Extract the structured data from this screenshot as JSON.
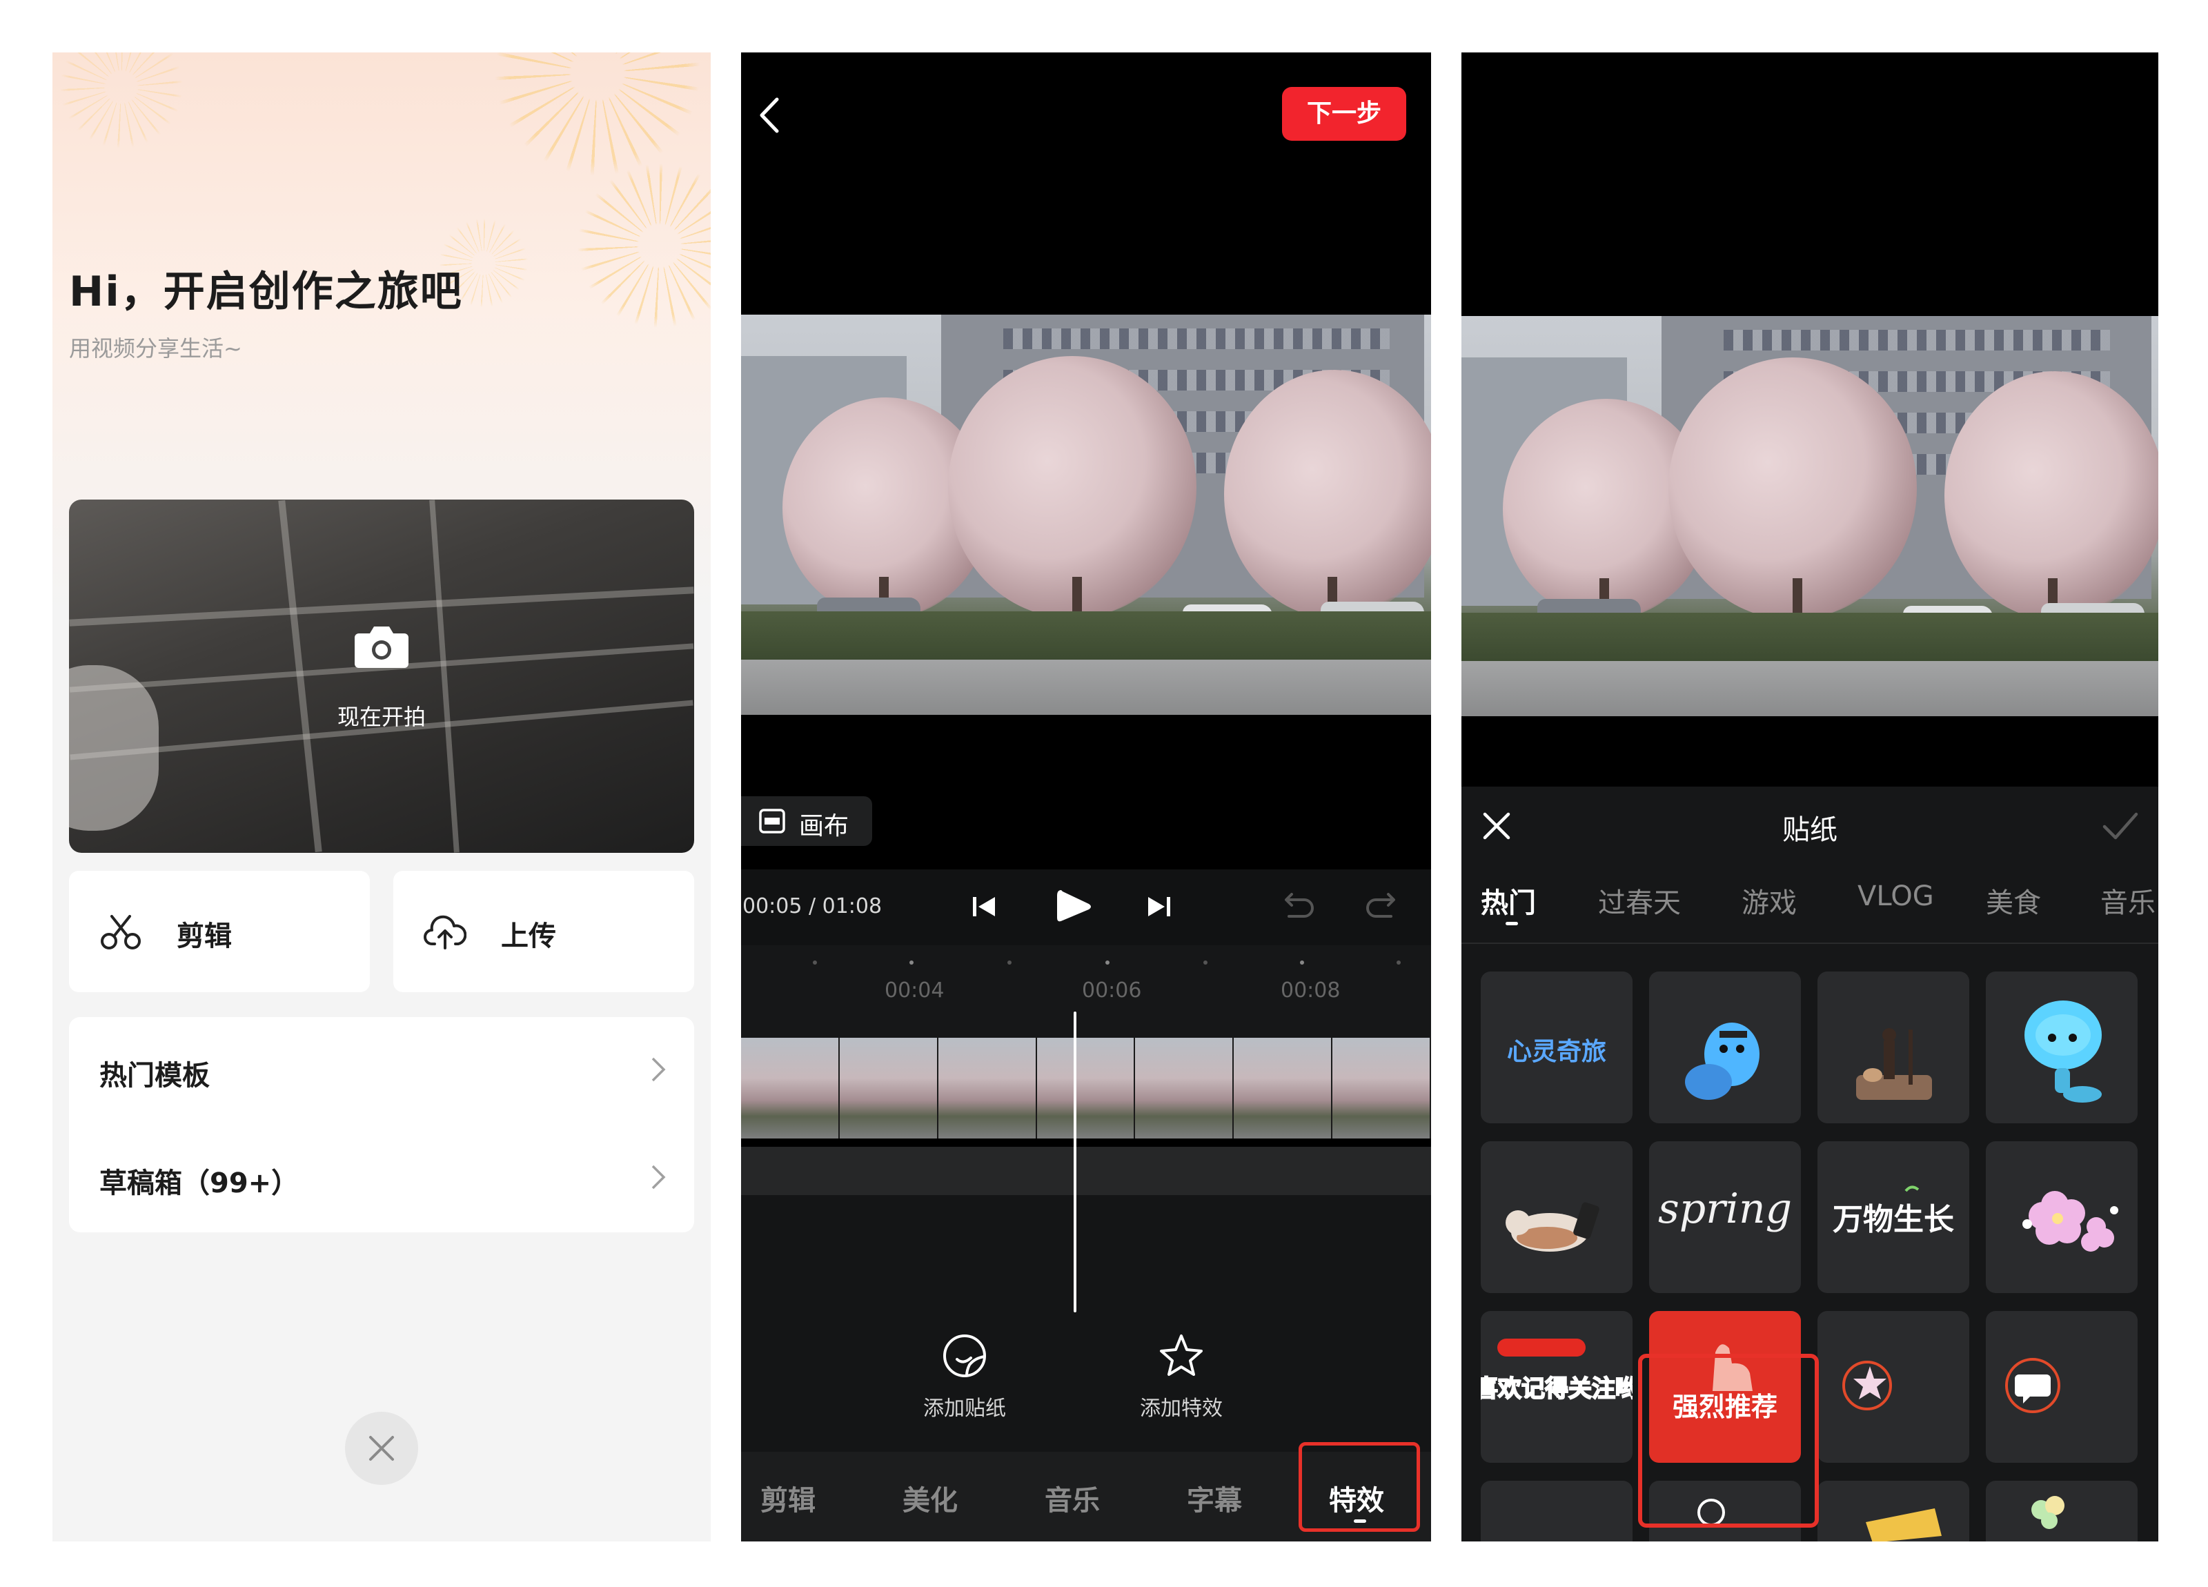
{
  "home": {
    "greeting": "Hi，开启创作之旅吧",
    "subtitle": "用视频分享生活~",
    "camera_label": "现在开拍",
    "actions": [
      {
        "label": "剪辑",
        "icon": "scissors-icon"
      },
      {
        "label": "上传",
        "icon": "cloud-upload-icon"
      }
    ],
    "list": [
      {
        "label": "热门模板"
      },
      {
        "label": "草稿箱（99+）"
      }
    ],
    "close_icon": "close-icon"
  },
  "editor": {
    "next_label": "下一步",
    "canvas_label": "画布",
    "time": "00:05 / 01:08",
    "ticks": [
      "00:04",
      "00:06",
      "00:08"
    ],
    "add_sticker_label": "添加贴纸",
    "add_effect_label": "添加特效",
    "tabs": [
      "剪辑",
      "美化",
      "音乐",
      "字幕",
      "特效"
    ],
    "active_tab": "特效",
    "accent": "#f2242d",
    "highlight": "#e83129"
  },
  "stickers": {
    "title": "贴纸",
    "categories": [
      "热门",
      "过春天",
      "游戏",
      "VLOG",
      "美食",
      "音乐"
    ],
    "active_category": "热门",
    "items": [
      {
        "text": "心灵奇旅",
        "icon": "soul-logo-sticker"
      },
      {
        "text": "",
        "icon": "blue-soul-character-sticker"
      },
      {
        "text": "",
        "icon": "musician-scene-sticker"
      },
      {
        "text": "",
        "icon": "blue-soul-head-sticker"
      },
      {
        "text": "",
        "icon": "cat-phone-sticker"
      },
      {
        "text": "spring",
        "icon": "spring-script-sticker"
      },
      {
        "text": "万物生长",
        "icon": "growth-text-sticker"
      },
      {
        "text": "",
        "icon": "cherry-blossom-sticker"
      },
      {
        "text": "喜欢记得关注哟",
        "icon": "follow-reminder-sticker"
      },
      {
        "text": "强烈推荐",
        "icon": "strongly-recommend-sticker"
      },
      {
        "text": "",
        "icon": "star-badge-sticker"
      },
      {
        "text": "",
        "icon": "chat-bubble-sticker"
      }
    ]
  }
}
